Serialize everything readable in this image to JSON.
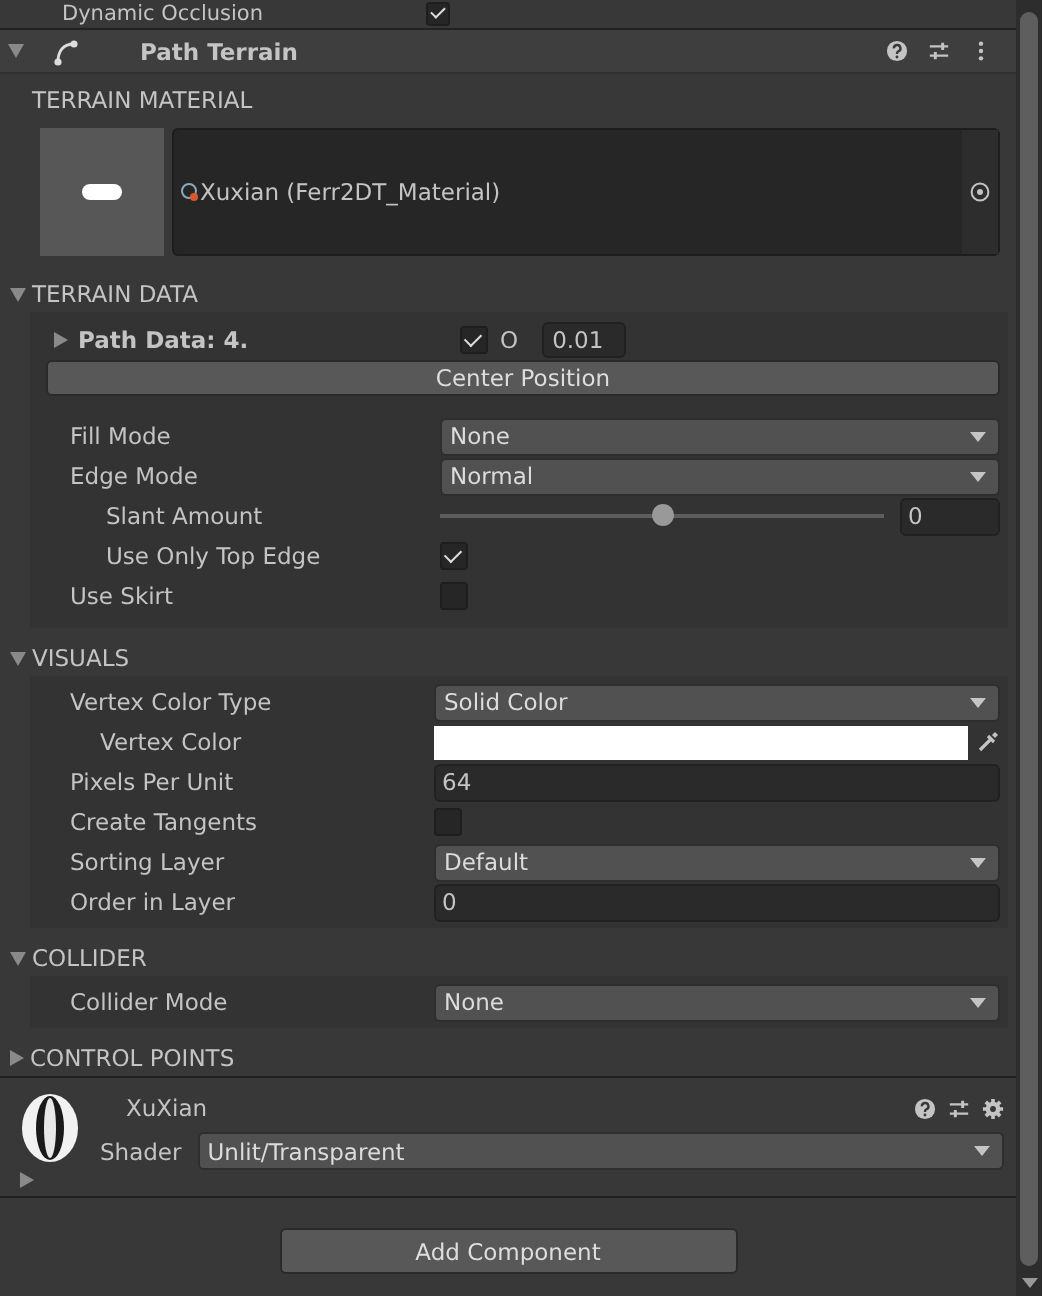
{
  "cut_row": {
    "label": "Dynamic Occlusion",
    "checked": true
  },
  "component": {
    "title": "Path Terrain",
    "expanded": true
  },
  "material_section": {
    "title": "TERRAIN MATERIAL",
    "material": "Xuxian (Ferr2DT_Material)"
  },
  "sections": [
    {
      "title": "TERRAIN DATA",
      "expanded": true,
      "rows": [
        {
          "kind": "pathdata",
          "label": "Path Data: 4.",
          "expanded": false,
          "checked": true,
          "toggle_label": "O",
          "value": "0.01"
        },
        {
          "kind": "button",
          "label": "Center Position"
        },
        {
          "kind": "gap"
        },
        {
          "kind": "dropdown",
          "label": "Fill Mode",
          "value": "None"
        },
        {
          "kind": "dropdown",
          "label": "Edge Mode",
          "value": "Normal",
          "children": [
            {
              "kind": "slider",
              "label": "Slant Amount",
              "level": 0.5,
              "value": "0"
            },
            {
              "kind": "checkbox",
              "label": "Use Only Top Edge",
              "checked": true
            }
          ]
        },
        {
          "kind": "checkbox",
          "label": "Use Skirt",
          "checked": false
        }
      ]
    },
    {
      "title": "VISUALS",
      "expanded": true,
      "rows": [
        {
          "kind": "dropdown",
          "label": "Vertex Color Type",
          "value": "Solid Color",
          "children": [
            {
              "kind": "color",
              "label": "Vertex Color",
              "color": "#ffffff"
            }
          ]
        },
        {
          "kind": "number",
          "label": "Pixels Per Unit",
          "value": "64"
        },
        {
          "kind": "checkbox",
          "label": "Create Tangents",
          "checked": false
        },
        {
          "kind": "dropdown",
          "label": "Sorting Layer",
          "value": "Default"
        },
        {
          "kind": "number",
          "label": "Order in Layer",
          "value": "0"
        }
      ]
    },
    {
      "title": "COLLIDER",
      "expanded": true,
      "rows": [
        {
          "kind": "dropdown",
          "label": "Collider Mode",
          "value": "None"
        }
      ]
    },
    {
      "title": "CONTROL POINTS",
      "expanded": false
    }
  ],
  "material_asset": {
    "name": "XuXian",
    "expanded": false,
    "shader_label": "Shader",
    "shader": "Unlit/Transparent"
  },
  "add_component": "Add Component"
}
